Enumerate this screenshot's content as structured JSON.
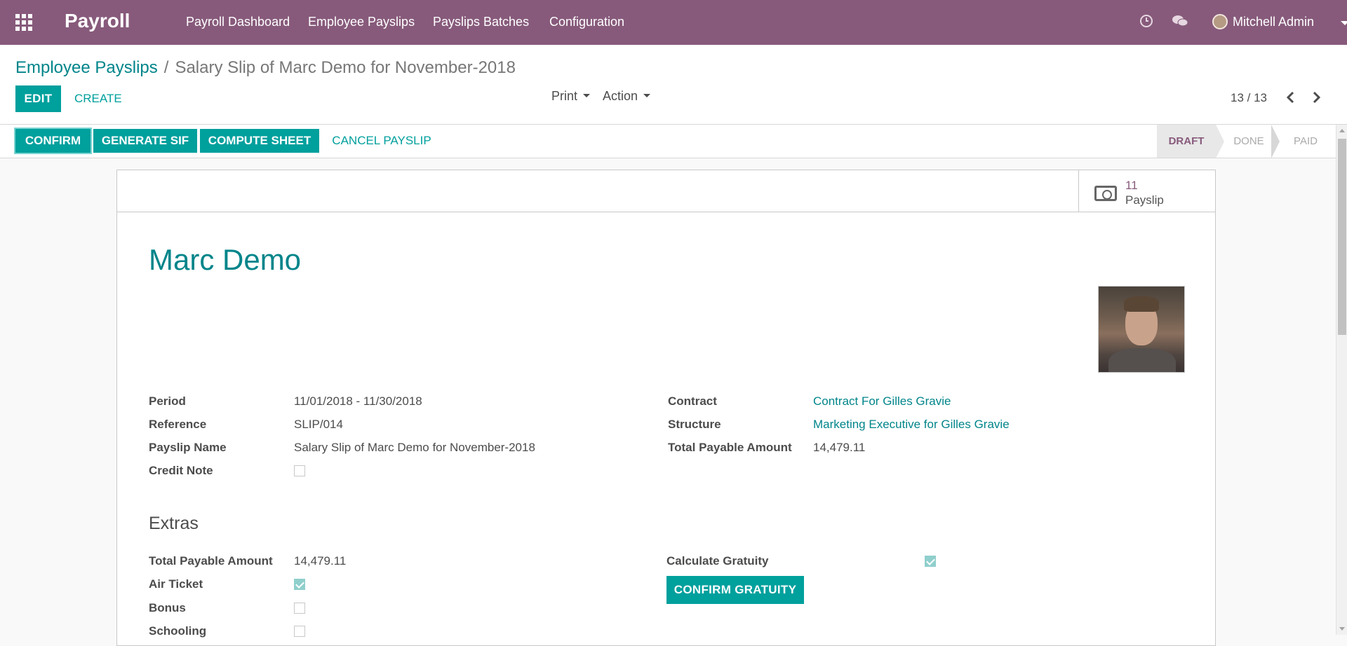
{
  "navbar": {
    "app_name": "Payroll",
    "menu": [
      "Payroll Dashboard",
      "Employee Payslips",
      "Payslips Batches",
      "Configuration"
    ],
    "user_name": "Mitchell Admin",
    "icons": [
      "apps-grid-icon",
      "clock-icon",
      "chat-icon"
    ]
  },
  "breadcrumb": {
    "parent": "Employee Payslips",
    "separator": "/",
    "current": "Salary Slip of Marc Demo for November-2018"
  },
  "control_panel": {
    "edit_label": "EDIT",
    "create_label": "CREATE",
    "print_label": "Print",
    "action_label": "Action",
    "pager": "13 / 13"
  },
  "statusbar": {
    "buttons": [
      "CONFIRM",
      "GENERATE SIF",
      "COMPUTE SHEET",
      "CANCEL PAYSLIP"
    ],
    "stages": [
      "DRAFT",
      "DONE",
      "PAID"
    ],
    "active_stage": "DRAFT"
  },
  "smart_button": {
    "value": "11",
    "label": "Payslip"
  },
  "employee": {
    "name": "Marc Demo"
  },
  "fields_left": [
    {
      "label": "Period",
      "value": "11/01/2018 - 11/30/2018"
    },
    {
      "label": "Reference",
      "value": "SLIP/014"
    },
    {
      "label": "Payslip Name",
      "value": "Salary Slip of Marc Demo for November-2018"
    },
    {
      "label": "Credit Note",
      "value": ""
    }
  ],
  "fields_right": [
    {
      "label": "Contract",
      "value": "Contract For Gilles Gravie"
    },
    {
      "label": "Structure",
      "value": "Marketing Executive for Gilles Gravie"
    },
    {
      "label": "Total Payable Amount",
      "value": "14,479.11"
    }
  ],
  "extras": {
    "title": "Extras",
    "left": [
      {
        "label": "Total Payable Amount",
        "value": "14,479.11"
      },
      {
        "label": "Air Ticket",
        "checked": true
      },
      {
        "label": "Bonus",
        "checked": false
      },
      {
        "label": "Schooling",
        "checked": false
      }
    ],
    "calculate_gratuity_label": "Calculate Gratuity",
    "calculate_gratuity_checked": true,
    "confirm_gratuity_label": "CONFIRM GRATUITY"
  },
  "colors": {
    "brand": "#875a7b",
    "primary": "#00a09d",
    "link": "#00858a"
  }
}
